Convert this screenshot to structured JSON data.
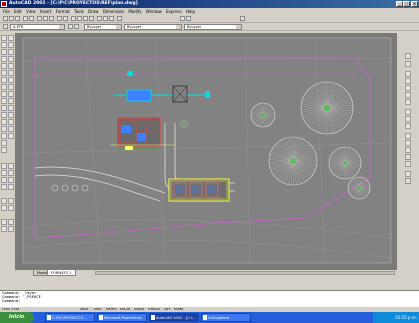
{
  "window": {
    "title": "AutoCAD 2002 - [C:\\P\\C\\PROYECTOS\\REF\\plan.dwg]"
  },
  "menu": [
    "File",
    "Edit",
    "View",
    "Insert",
    "Format",
    "Tools",
    "Draw",
    "Dimension",
    "Modify",
    "Window",
    "Express",
    "Help"
  ],
  "layers": {
    "current_layer": "A-ETR",
    "color": "ByLayer",
    "linetype": "ByLayer",
    "lineweight": "ByLayer"
  },
  "tabs": [
    "Model",
    "FORMATO 1"
  ],
  "command_lines": [
    "Command: _layer",
    "Command: '_PSPACE",
    "Command:"
  ],
  "status": {
    "coords": "1184, 2156",
    "toggles": [
      "SNAP",
      "GRID",
      "ORTHO",
      "POLAR",
      "OSNAP",
      "OTRACK",
      "LWT",
      "PAPER"
    ]
  },
  "taskbar": {
    "start_label": "Inicio",
    "tasks": [
      "C:\\P\\C\\PROYECTO...",
      "Microsoft PowerPoint...",
      "AutoCAD 2002 - [C:\\...",
      "Calculadora"
    ],
    "clock": "01:25 p.m."
  }
}
